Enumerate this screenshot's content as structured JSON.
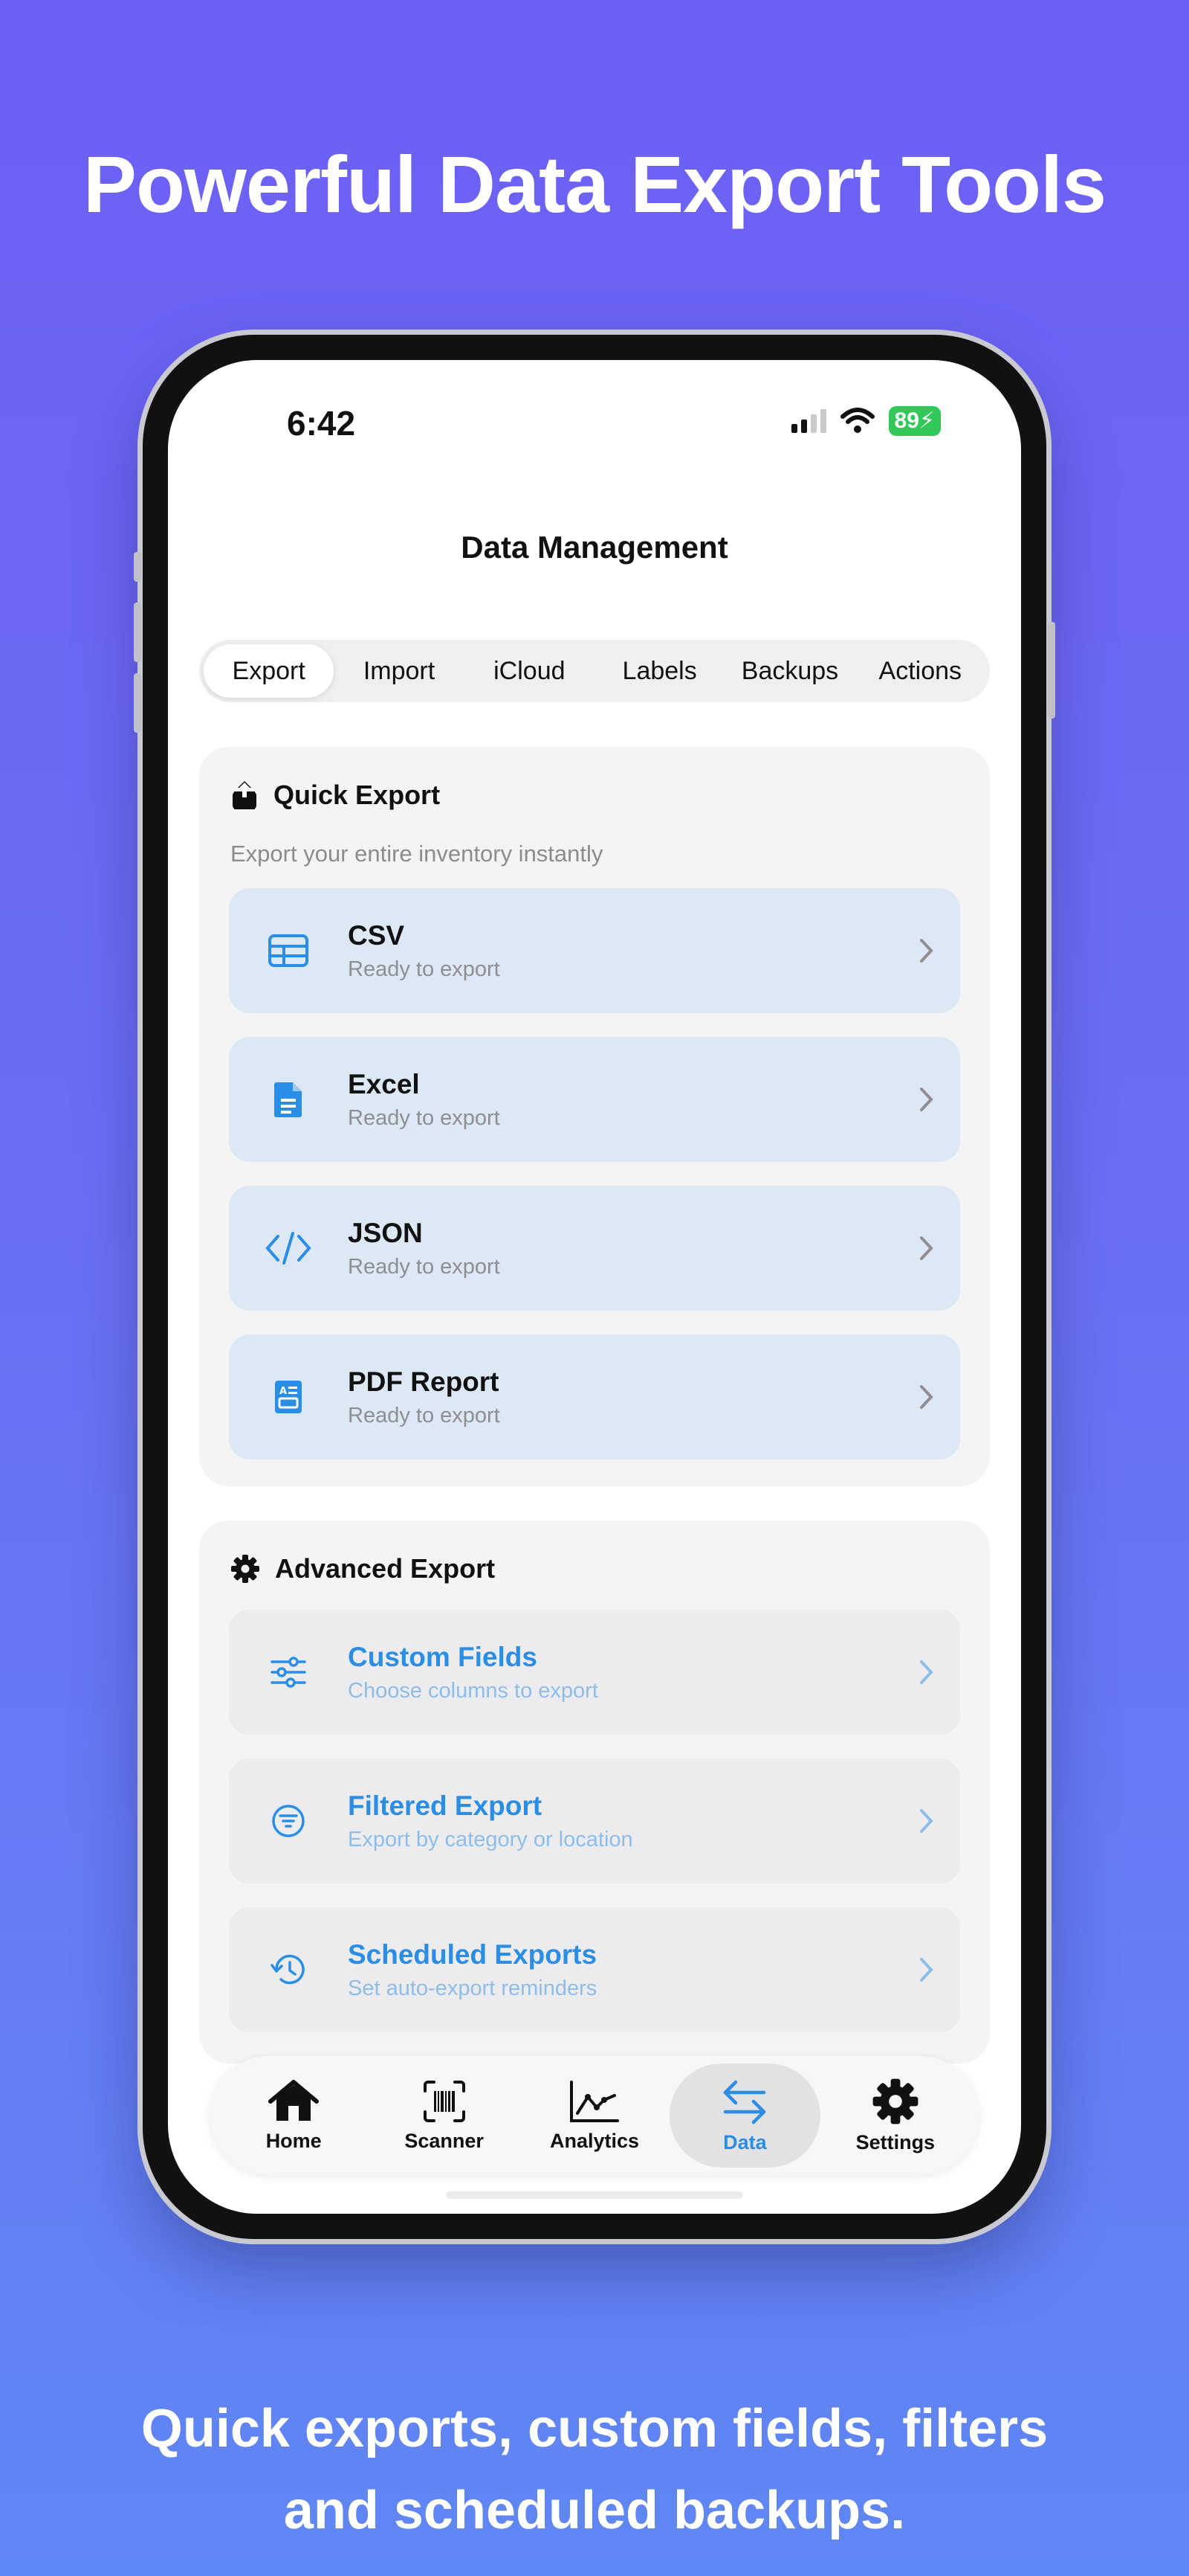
{
  "headline": "Powerful Data Export Tools",
  "subline": [
    "Quick exports, custom fields, filters",
    "and scheduled backups."
  ],
  "status": {
    "time": "6:42",
    "battery": "89"
  },
  "nav": {
    "title": "Data Management"
  },
  "segments": [
    {
      "label": "Export",
      "active": true
    },
    {
      "label": "Import",
      "active": false
    },
    {
      "label": "iCloud",
      "active": false
    },
    {
      "label": "Labels",
      "active": false
    },
    {
      "label": "Backups",
      "active": false
    },
    {
      "label": "Actions",
      "active": false
    }
  ],
  "quick_export": {
    "title": "Quick Export",
    "subtitle": "Export your entire inventory instantly",
    "icon": "share-icon",
    "items": [
      {
        "title": "CSV",
        "desc": "Ready to export",
        "icon": "table-icon"
      },
      {
        "title": "Excel",
        "desc": "Ready to export",
        "icon": "document-icon"
      },
      {
        "title": "JSON",
        "desc": "Ready to export",
        "icon": "code-icon"
      },
      {
        "title": "PDF Report",
        "desc": "Ready to export",
        "icon": "report-icon"
      }
    ]
  },
  "advanced_export": {
    "title": "Advanced Export",
    "icon": "gear-icon",
    "items": [
      {
        "title": "Custom Fields",
        "desc": "Choose columns to export",
        "icon": "sliders-icon"
      },
      {
        "title": "Filtered Export",
        "desc": "Export by category or location",
        "icon": "filter-icon"
      },
      {
        "title": "Scheduled Exports",
        "desc": "Set auto-export reminders",
        "icon": "history-icon"
      }
    ]
  },
  "tabbar": [
    {
      "label": "Home",
      "icon": "house-icon",
      "active": false
    },
    {
      "label": "Scanner",
      "icon": "barcode-icon",
      "active": false
    },
    {
      "label": "Analytics",
      "icon": "chart-icon",
      "active": false
    },
    {
      "label": "Data",
      "icon": "arrows-icon",
      "active": true
    },
    {
      "label": "Settings",
      "icon": "gear-icon",
      "active": false
    }
  ],
  "colors": {
    "accent": "#2b8ee6",
    "bg_top": "#6c5ff5",
    "bg_bottom": "#5f87f3",
    "row_blue": "#dce8f4"
  }
}
